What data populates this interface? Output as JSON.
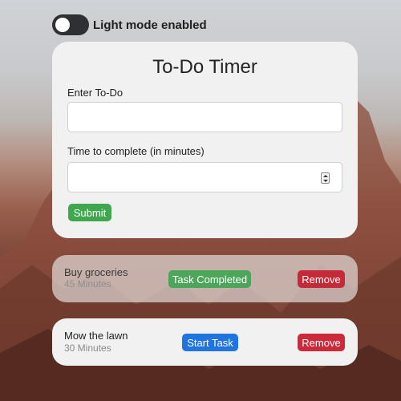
{
  "toggle": {
    "label": "Light mode enabled",
    "checked": false
  },
  "form": {
    "title": "To-Do Timer",
    "todo_label": "Enter To-Do",
    "todo_value": "",
    "time_label": "Time to complete (in minutes)",
    "time_value": "",
    "submit_label": "Submit"
  },
  "tasks": [
    {
      "name": "Buy groceries",
      "minutes": "45 Minutes",
      "action_label": "Task Completed",
      "remove_label": "Remove",
      "status": "completed"
    },
    {
      "name": "Mow the lawn",
      "minutes": "30 Minutes",
      "action_label": "Start Task",
      "remove_label": "Remove",
      "status": "pending"
    }
  ],
  "colors": {
    "submit": "#3fa84f",
    "completed": "#4ba65a",
    "start": "#1f74e0",
    "remove": "#cc2a3a"
  }
}
